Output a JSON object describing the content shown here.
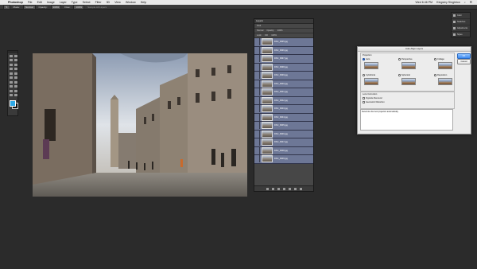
{
  "menubar": {
    "app": "Photoshop",
    "items": [
      "File",
      "Edit",
      "Image",
      "Layer",
      "Type",
      "Select",
      "Filter",
      "3D",
      "View",
      "Window",
      "Help"
    ],
    "clock": "Wed 6:46 PM",
    "user": "Kingsley Singleton"
  },
  "options_bar": {
    "mode_label": "Mode:",
    "mode_value": "Normal",
    "opacity_label": "Opacity:",
    "opacity_value": "100%",
    "flow_label": "Flow:",
    "flow_value": "100%",
    "extra": "Sample All Layers"
  },
  "layers_panel": {
    "tab": "Layers",
    "kind_label": "Kind",
    "blend": "Normal",
    "opacity_label": "Opacity:",
    "opacity_value": "100%",
    "lock_label": "Lock:",
    "fill_label": "Fill:",
    "fill_value": "100%",
    "layers": [
      "DSC_0935.jpg",
      "DSC_0936.jpg",
      "DSC_0937.jpg",
      "DSC_0938.jpg",
      "DSC_0939.jpg",
      "DSC_0940.jpg",
      "DSC_0941.jpg",
      "DSC_0942.jpg",
      "DSC_0943.jpg",
      "DSC_0944.jpg",
      "DSC_0945.jpg",
      "DSC_0946.jpg",
      "DSC_0947.jpg",
      "DSC_0948.jpg",
      "DSC_0949.jpg"
    ]
  },
  "mini_panel": {
    "items": [
      "Color",
      "Swatches",
      "Adjustments",
      "Styles"
    ]
  },
  "dialog": {
    "title": "Auto-Align Layers",
    "projection_label": "Projection",
    "options": [
      "Auto",
      "Perspective",
      "Collage",
      "Cylindrical",
      "Spherical",
      "Reposition"
    ],
    "selected": "Auto",
    "lens_label": "Lens Correction",
    "vignette": "Vignette Removal",
    "distortion": "Geometric Distortion",
    "ok": "OK",
    "cancel": "Cancel",
    "description": "Determine the best projection automatically."
  }
}
